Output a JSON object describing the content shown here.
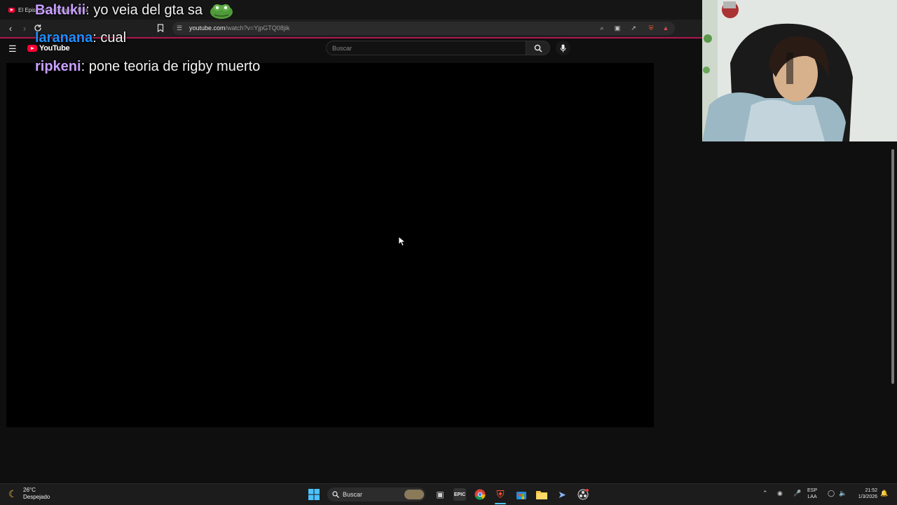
{
  "browser": {
    "tab_title": "El Episodio de Balance Más",
    "url": "youtube.com/watch?v=YjpGTQ08jik",
    "url_host": "youtube.com",
    "url_path": "/watch?v=YjpGTQ08jik"
  },
  "youtube": {
    "logo_text": "YouTube",
    "search_placeholder": "Buscar"
  },
  "chat": [
    {
      "user": "Baltukii",
      "user_color": "#c9a0ff",
      "message": ": yo veia del gta sa"
    },
    {
      "user": "laranana",
      "user_color": "#1e90ff",
      "message": ": cual"
    },
    {
      "user": "ripkeni",
      "user_color": "#c9a0ff",
      "message": ": pone teoria de rigby muerto"
    }
  ],
  "taskbar": {
    "weather_temp": "26°C",
    "weather_desc": "Despejado",
    "search_label": "Buscar",
    "lang_top": "ESP",
    "lang_bottom": "LAA",
    "time": "21:52",
    "date": "1/3/2026"
  },
  "colors": {
    "accent_bar": "#b0174f",
    "youtube_red": "#ff0033",
    "windows_blue": "#4cc2ff"
  }
}
